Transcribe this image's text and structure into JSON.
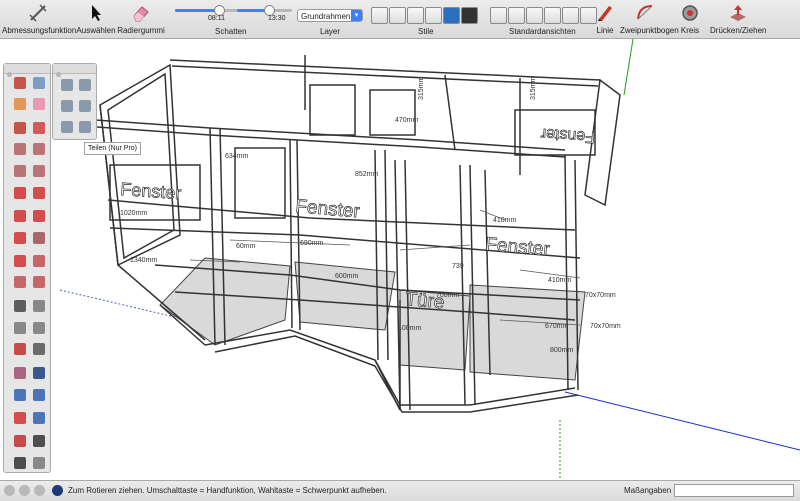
{
  "toolbar": {
    "dimension_tool": "Abmessungsfunktion",
    "select_tool": "Auswählen",
    "eraser_tool": "Radiergummi",
    "shadows_label": "Schatten",
    "shadow_time_start": "08:11",
    "shadow_time_end": "13:30",
    "layer_label": "Layer",
    "layer_value": "Grundrahmen",
    "styles_label": "Stile",
    "standard_views_label": "Standardansichten",
    "line_tool": "Linie",
    "arc_tool": "Zweipunktbogen",
    "circle_tool": "Kreis",
    "pushpull_tool": "Drücken/Ziehen",
    "accent_color": "#3b82f6"
  },
  "tooltip": "Teilen (Nur Pro)",
  "model_labels": {
    "fenster": "Fenster",
    "tuere": "Türe",
    "dim_1020": "1020mm",
    "dim_634": "634mm",
    "dim_470": "470mm",
    "dim_315": "315mm",
    "dim_1340": "1340mm",
    "dim_852": "852mm",
    "dim_70x70": "70x70mm",
    "dim_700": "700mm",
    "dim_670": "670mm",
    "dim_739": "739",
    "dim_60": "60mm",
    "dim_410": "410mm",
    "dim_690": "690mm",
    "dim_600": "600mm",
    "dim_100": "100mm",
    "dim_800": "800mm"
  },
  "statusbar": {
    "message": "Zum Rotieren ziehen. Umschalttaste = Handfunktion, Wahltaste = Schwerpunkt aufheben.",
    "measurements_label": "Maßangaben",
    "measurements_value": ""
  }
}
